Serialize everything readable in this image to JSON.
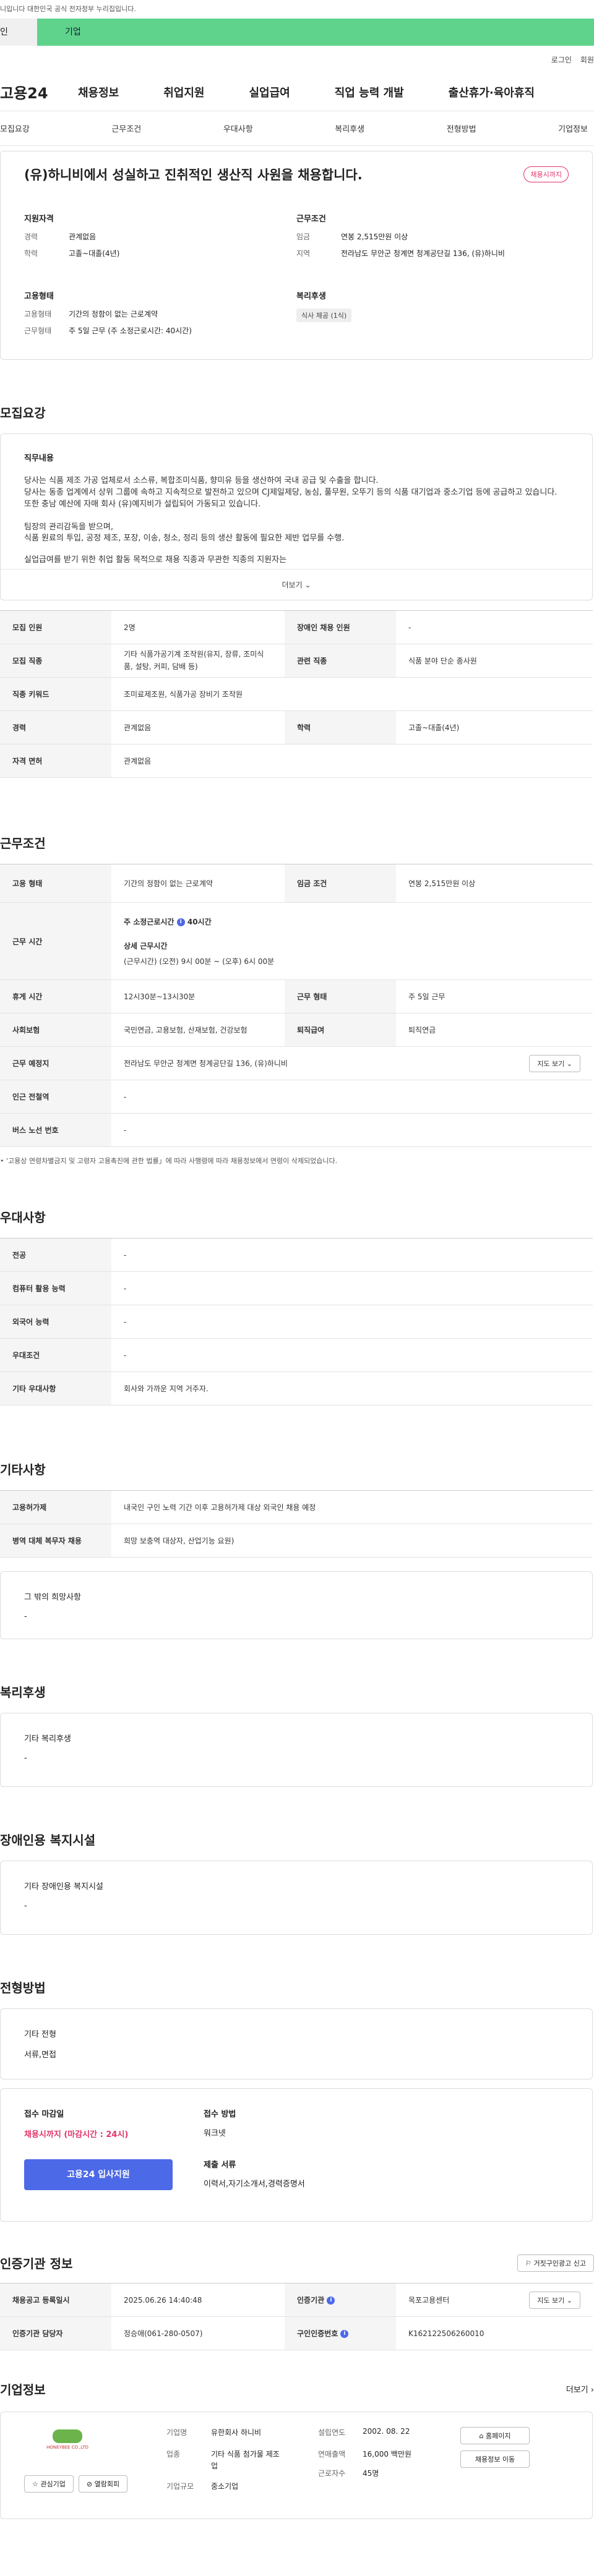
{
  "notice": "니입니다 대한민국 공식 전자정부 누리집입니다.",
  "site_tabs": [
    "인",
    "기업"
  ],
  "util": {
    "login": "로그인",
    "join": "회원"
  },
  "logo": "고용24",
  "gnb": [
    "채용정보",
    "취업지원",
    "실업급여",
    "직업 능력 개발",
    "출산휴가·육아휴직"
  ],
  "anchors": [
    "모집요강",
    "근무조건",
    "우대사항",
    "복리후생",
    "전형방법",
    "기업정보"
  ],
  "summary": {
    "title": "(유)하니비에서 성실하고 진취적인 생산직 사원을 채용합니다.",
    "status": "채용시까지",
    "qual_title": "지원자격",
    "qual": [
      {
        "k": "경력",
        "v": "관계없음"
      },
      {
        "k": "학력",
        "v": "고졸~대졸(4년)"
      }
    ],
    "cond_title": "근무조건",
    "cond": [
      {
        "k": "임금",
        "v": "연봉 2,515만원 이상"
      },
      {
        "k": "지역",
        "v": "전라남도 무안군 청계면 청계공단길 136, (유)하니비"
      }
    ],
    "emp_title": "고용형태",
    "emp": [
      {
        "k": "고용형태",
        "v": "기간의 정함이 없는 근로계약"
      },
      {
        "k": "근무형태",
        "v": "주 5일 근무 (주 소정근로시간: 40시간)"
      }
    ],
    "welfare_title": "복리후생",
    "welfare_chip": "식사 제공 (1식)"
  },
  "recruit": {
    "title": "모집요강",
    "desc_title": "직무내용",
    "desc_lines": [
      "당사는 식품 제조 가공 업체로서 소스류, 복합조미식품, 향미유 등을 생산하여 국내 공급 및 수출을 합니다.",
      "당사는 동종 업계에서 상위 그룹에 속하고 지속적으로 발전하고 있으며 CJ제일제당, 농심, 풀무원, 오뚜기 등의 식품 대기업과 중소기업 등에 공급하고 있습니다.",
      "또한 충남 예산에 자매 회사 (유)예지비가 설립되어 가동되고 있습니다.",
      "",
      "팀장의 관리감독을 받으며,",
      "식품 원료의 투입, 공정 제조, 포장, 이송, 청소, 정리 등의 생산 활동에 필요한 제반 업무를 수행.",
      "",
      "  실업급여를 받기 위한 취업 활동 목적으로 채용 직종과 무관한 직종의 지원자는"
    ],
    "more": "더보기",
    "rows": [
      {
        "k": "모집 인원",
        "v": "2명",
        "k2": "장애인 채용 인원",
        "v2": "-"
      },
      {
        "k": "모집 직종",
        "v": "기타 식품가공기계 조작원(유지, 장류, 조미식품, 설탕, 커피, 담배 등)",
        "k2": "관련 직종",
        "v2": "식품 분야 단순 종사원"
      },
      {
        "k": "직종 키워드",
        "v": "조미료제조원, 식품가공 장비기 조작원"
      },
      {
        "k": "경력",
        "v": "관계없음",
        "k2": "학력",
        "v2": "고졸~대졸(4년)"
      },
      {
        "k": "자격 면허",
        "v": "관계없음"
      }
    ]
  },
  "work": {
    "title": "근무조건",
    "emp_k": "고용 형태",
    "emp_v": "기간의 정함이 없는 근로계약",
    "wage_k": "임금 조건",
    "wage_v": "연봉 2,515만원 이상",
    "time_k": "근무 시간",
    "time_main": "주 소정근로시간",
    "time_hours": "40시간",
    "time_detail_title": "상세 근무시간",
    "time_detail": "(근무시간) (오전) 9시 00분 ~ (오후) 6시 00분",
    "break_k": "휴게 시간",
    "break_v": "12시30분~13시30분",
    "form_k": "근무 형태",
    "form_v": "주 5일 근무",
    "ins_k": "사회보험",
    "ins_v": "국민연금, 고용보험, 산재보험, 건강보험",
    "ret_k": "퇴직급여",
    "ret_v": "퇴직연금",
    "place_k": "근무 예정지",
    "place_v": "전라남도 무안군 청계면 청계공단길 136, (유)하니비",
    "map": "지도 보기",
    "sub_k": "인근 전철역",
    "sub_v": "-",
    "bus_k": "버스 노선 번호",
    "bus_v": "-",
    "note": "'고용상 연령차별금지 및 고령자 고용촉진에 관한 법률」에 따라 사행령에 따라 채용정보에서 연령이 삭제되었습니다."
  },
  "pref": {
    "title": "우대사항",
    "rows": [
      {
        "k": "전공",
        "v": "-"
      },
      {
        "k": "컴퓨터 활용 능력",
        "v": "-"
      },
      {
        "k": "외국어 능력",
        "v": "-"
      },
      {
        "k": "우대조건",
        "v": "-"
      },
      {
        "k": "기타 우대사항",
        "v": "회사와 가까운 지역 거주자."
      }
    ]
  },
  "etc": {
    "title": "기타사항",
    "rows": [
      {
        "k": "고용허가제",
        "v": "내국인 구인 노력 기간 이후 고용허가제 대상 외국인 채용 예정"
      },
      {
        "k": "병역 대체 복무자 채용",
        "v": "희망 보충역 대상자, 산업기능 요원)"
      }
    ],
    "other_title": "그 밖의 희망사항",
    "other_v": "-"
  },
  "welfare": {
    "title": "복리후생",
    "sub": "기타 복리후생",
    "v": "-"
  },
  "disabled": {
    "title": "장애인용 복지시설",
    "sub": "기타 장애인용 복지시설",
    "v": "-"
  },
  "selection": {
    "title": "전형방법",
    "sub": "기타 전형",
    "v": "서류,면접",
    "deadline_k": "접수 마감일",
    "deadline_v": "채용시까지 (마감시간 : 24시)",
    "apply": "고용24 입사지원",
    "method_k": "접수 방법",
    "method_v": "워크넷",
    "docs_k": "제출 서류",
    "docs_v": "이력서,자기소개서,경력증명서"
  },
  "auth": {
    "title": "인증기관 정보",
    "report": "거짓구인광고 신고",
    "reg_k": "채용공고 등록일시",
    "reg_v": "2025.06.26 14:40:48",
    "org_k": "인증기관",
    "org_v": "목포고용센터",
    "map": "지도 보기",
    "mgr_k": "인증기관 담당자",
    "mgr_v": "정승애(061-280-0507)",
    "id_k": "구인인증번호",
    "id_v": "K162122506260010"
  },
  "company": {
    "title": "기업정보",
    "more": "더보기",
    "logo_text": "HONEYBEE CO.,LTD",
    "interest": "관심기업",
    "avoid": "열람회피",
    "name_k": "기업명",
    "name_v": "유한회사 하니비",
    "ind_k": "업종",
    "ind_v": "기타 식품 첨가물 제조업",
    "size_k": "기업규모",
    "size_v": "중소기업",
    "est_k": "설립연도",
    "est_v": "2002. 08. 22",
    "sales_k": "연매출액",
    "sales_v": "16,000 백만원",
    "emp_k": "근로자수",
    "emp_v": "45명",
    "homepage": "홈페이지",
    "jobs": "채용정보 이동"
  }
}
